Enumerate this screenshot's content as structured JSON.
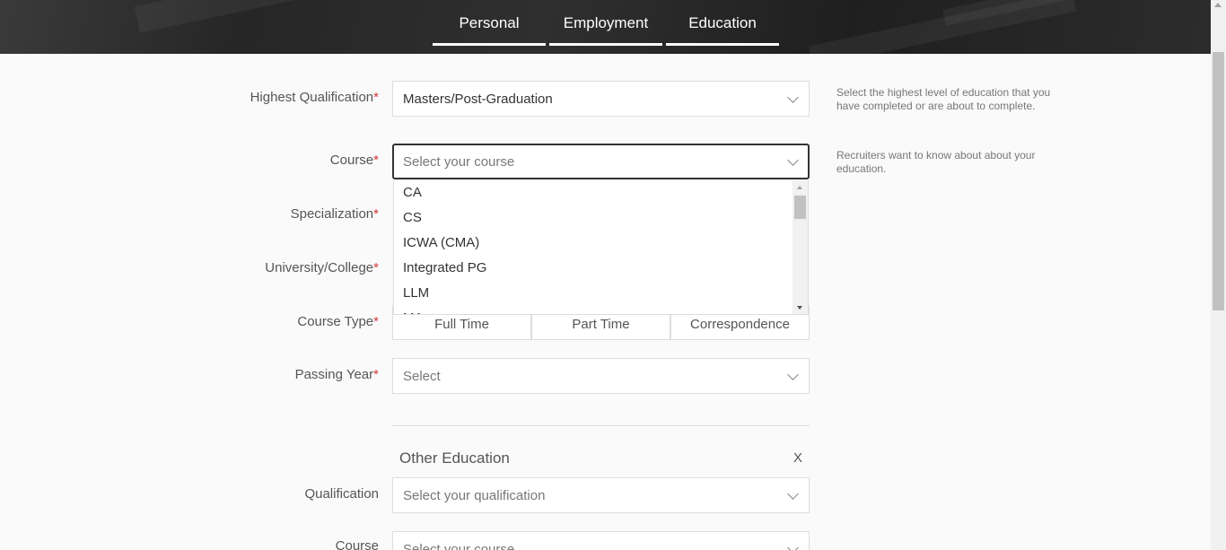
{
  "tabs": [
    {
      "label": "Personal"
    },
    {
      "label": "Employment"
    },
    {
      "label": "Education"
    }
  ],
  "form": {
    "highest_qualification": {
      "label": "Highest Qualification",
      "value": "Masters/Post-Graduation",
      "hint": "Select the highest level of education that you have completed or are about to complete."
    },
    "course": {
      "label": "Course",
      "placeholder": "Select your course",
      "hint": "Recruiters want to know about about your education."
    },
    "course_options": [
      "CA",
      "CS",
      "ICWA (CMA)",
      "Integrated PG",
      "LLM",
      "MA"
    ],
    "specialization": {
      "label": "Specialization"
    },
    "university": {
      "label": "University/College"
    },
    "course_type": {
      "label": "Course Type",
      "options": [
        "Full Time",
        "Part Time",
        "Correspondence"
      ]
    },
    "passing_year": {
      "label": "Passing Year",
      "placeholder": "Select"
    },
    "required_mark": "*"
  },
  "other_education": {
    "title": "Other Education",
    "close": "X",
    "qualification": {
      "label": "Qualification",
      "placeholder": "Select your qualification"
    },
    "course": {
      "label": "Course",
      "placeholder": "Select your course"
    }
  }
}
